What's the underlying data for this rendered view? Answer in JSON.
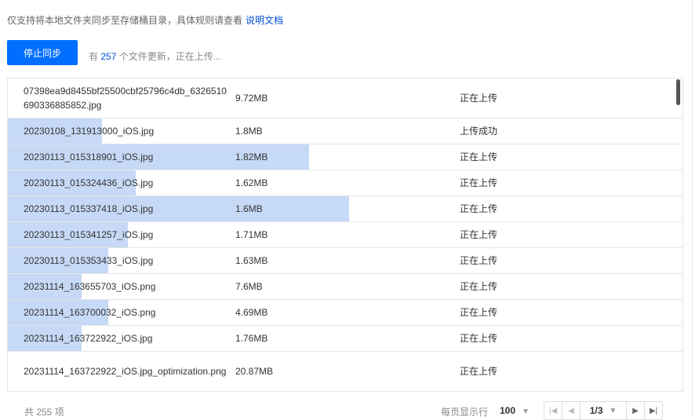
{
  "notice": {
    "text": "仅支持将本地文件夹同步至存储桶目录，具体规则请查看",
    "link": "说明文档"
  },
  "actions": {
    "stop_label": "停止同步"
  },
  "status": {
    "prefix": "有",
    "count": "257",
    "suffix": "个文件更新，正在上传..."
  },
  "colors": {
    "primary": "#006eff",
    "link": "#0052d9",
    "progress": "#c6d9f6"
  },
  "rows": [
    {
      "name": "07398ea9d8455bf25500cbf25796c4db_6326510690336885852.jpg",
      "size": "9.72MB",
      "status": "正在上传",
      "progress": 0
    },
    {
      "name": "20230108_131913000_iOS.jpg",
      "size": "1.8MB",
      "status": "上传成功",
      "progress": 0.139
    },
    {
      "name": "20230113_015318901_iOS.jpg",
      "size": "1.82MB",
      "status": "正在上传",
      "progress": 0.446
    },
    {
      "name": "20230113_015324436_iOS.jpg",
      "size": "1.62MB",
      "status": "正在上传",
      "progress": 0.189
    },
    {
      "name": "20230113_015337418_iOS.jpg",
      "size": "1.6MB",
      "status": "正在上传",
      "progress": 0.506
    },
    {
      "name": "20230113_015341257_iOS.jpg",
      "size": "1.71MB",
      "status": "正在上传",
      "progress": 0.178
    },
    {
      "name": "20230113_015353433_iOS.jpg",
      "size": "1.63MB",
      "status": "正在上传",
      "progress": 0.149
    },
    {
      "name": "20231114_163655703_iOS.png",
      "size": "7.6MB",
      "status": "正在上传",
      "progress": 0.109
    },
    {
      "name": "20231114_163700032_iOS.png",
      "size": "4.69MB",
      "status": "正在上传",
      "progress": 0.149
    },
    {
      "name": "20231114_163722922_iOS.jpg",
      "size": "1.76MB",
      "status": "正在上传",
      "progress": 0.109
    },
    {
      "name": "20231114_163722922_iOS.jpg_optimization.png",
      "size": "20.87MB",
      "status": "正在上传",
      "progress": 0
    }
  ],
  "footer": {
    "total": "共 255 项",
    "per_page_label": "每页显示行",
    "per_page_value": "100",
    "page_value": "1/3"
  },
  "icons": {
    "first": "first-page-icon",
    "prev": "prev-page-icon",
    "next": "next-page-icon",
    "last": "last-page-icon",
    "dropdown": "chevron-down-icon"
  }
}
